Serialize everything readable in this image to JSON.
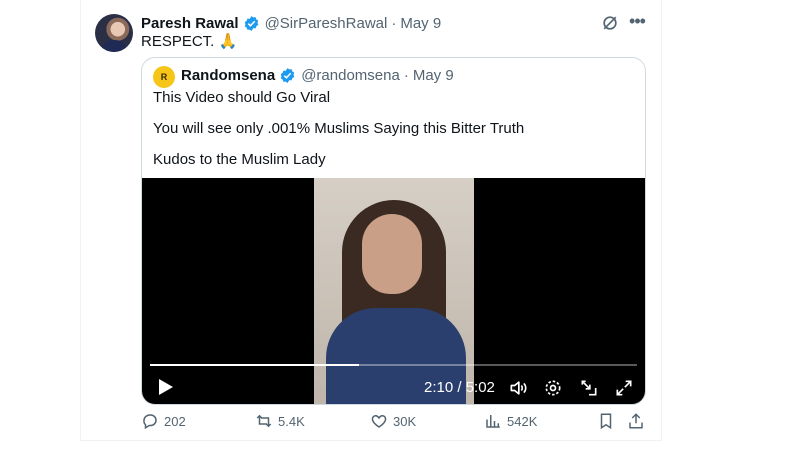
{
  "tweet": {
    "author_name": "Paresh Rawal",
    "handle": "@SirPareshRawal",
    "separator": "·",
    "date": "May 9",
    "text": "RESPECT. 🙏"
  },
  "quote": {
    "author_name": "Randomsena",
    "handle": "@randomsena",
    "separator": "·",
    "date": "May 9",
    "lines": [
      "This Video should Go Viral",
      "You will see only .001% Muslims Saying this Bitter Truth",
      "Kudos to the Muslim Lady"
    ]
  },
  "video": {
    "time_display": "2:10 / 5:02",
    "progress": 0.43
  },
  "actions": {
    "replies": "202",
    "reposts": "5.4K",
    "likes": "30K",
    "views": "542K"
  },
  "colors": {
    "verified": "#1d9bf0",
    "muted": "#536471",
    "text": "#0f1419",
    "border": "#cfd9de"
  },
  "icons": [
    "verified-badge-icon",
    "grok-icon",
    "more-icon",
    "play-icon",
    "volume-icon",
    "settings-icon",
    "pip-icon",
    "fullscreen-icon",
    "reply-icon",
    "repost-icon",
    "like-icon",
    "views-icon",
    "bookmark-icon",
    "share-icon"
  ]
}
